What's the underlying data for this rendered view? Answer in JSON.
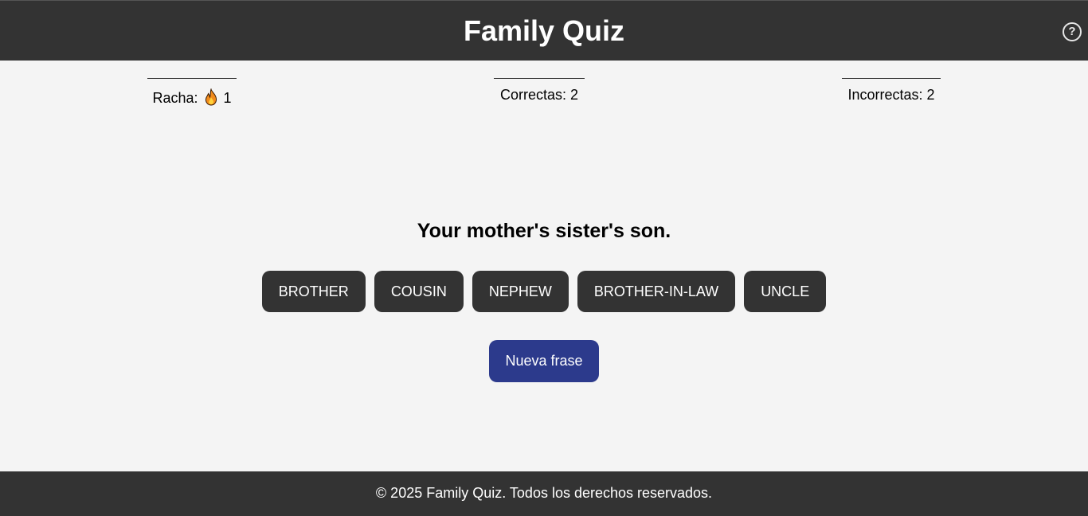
{
  "header": {
    "title": "Family Quiz",
    "help_symbol": "?"
  },
  "stats": {
    "streak_label": "Racha:",
    "streak_icon": "flame-icon",
    "streak_value": "1",
    "correct_text": "Correctas: 2",
    "incorrect_text": "Incorrectas: 2"
  },
  "quiz": {
    "question": "Your mother's sister's son.",
    "options": [
      "BROTHER",
      "COUSIN",
      "NEPHEW",
      "BROTHER-IN-LAW",
      "UNCLE"
    ],
    "new_phrase_label": "Nueva frase"
  },
  "footer": {
    "text": "© 2025 Family Quiz. Todos los derechos reservados."
  },
  "colors": {
    "header_bg": "#333333",
    "page_bg": "#f4f4f4",
    "option_bg": "#333333",
    "primary_button": "#2c3a8c"
  }
}
